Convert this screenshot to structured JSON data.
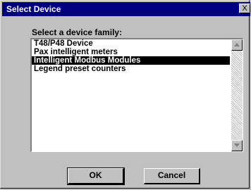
{
  "window": {
    "title": "Select Device",
    "close_glyph": "X"
  },
  "dialog": {
    "prompt": "Select a device family:",
    "devices": [
      {
        "label": "T48/P48 Device",
        "selected": false
      },
      {
        "label": "Pax intelligent meters",
        "selected": false
      },
      {
        "label": "Intelligent Modbus Modules",
        "selected": true
      },
      {
        "label": "Legend preset counters",
        "selected": false
      }
    ]
  },
  "buttons": {
    "ok_label": "OK",
    "cancel_label": "Cancel"
  },
  "colors": {
    "titlebar": "#000080",
    "selection": "#000000",
    "face": "#c0c0c0"
  }
}
